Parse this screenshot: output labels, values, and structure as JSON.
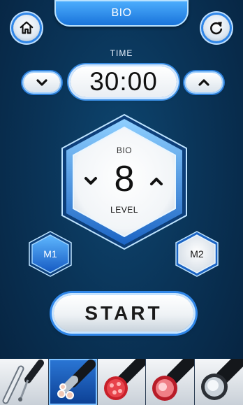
{
  "header": {
    "title": "BIO",
    "home_icon": "home-icon",
    "refresh_icon": "refresh-icon"
  },
  "timer": {
    "label": "TIME",
    "value": "30:00",
    "down_icon": "chevron-down-icon",
    "up_icon": "chevron-up-icon"
  },
  "level": {
    "mode": "BIO",
    "value": "8",
    "unit": "LEVEL"
  },
  "modes": [
    {
      "label": "M1",
      "selected": true
    },
    {
      "label": "M2",
      "selected": false
    }
  ],
  "start_label": "START",
  "tools": [
    {
      "icon": "wand-probe-icon",
      "active": false
    },
    {
      "icon": "bio-handpiece-icon",
      "active": true
    },
    {
      "icon": "red-led-handpiece-icon",
      "active": false
    },
    {
      "icon": "rf-handpiece-icon",
      "active": false
    },
    {
      "icon": "cool-handpiece-icon",
      "active": false
    }
  ],
  "colors": {
    "accent": "#2f86e8",
    "background": "#0a3458",
    "active_tool": "#1c5fbf"
  }
}
